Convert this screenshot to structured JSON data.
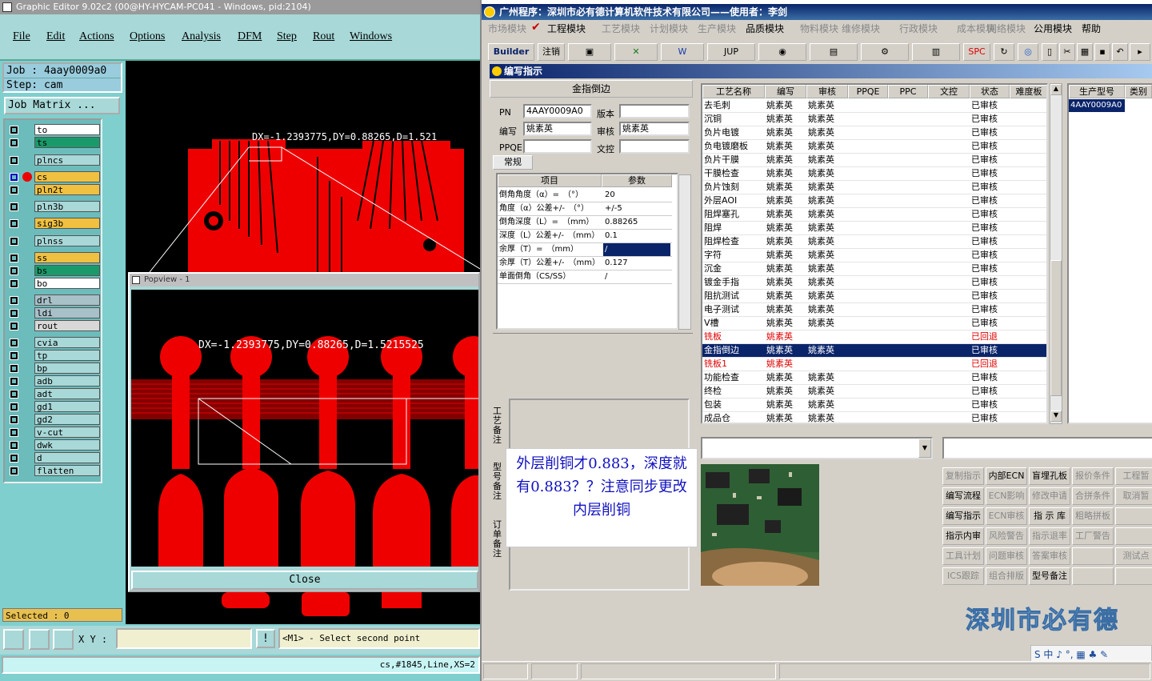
{
  "ge": {
    "title": "Graphic Editor 9.02c2 (00@HY-HYCAM-PC041 - Windows, pid:2104)",
    "menu": [
      "File",
      "Edit",
      "Actions",
      "Options",
      "Analysis",
      "DFM",
      "Step",
      "Rout",
      "Windows"
    ],
    "job": "Job : 4aay0009a0",
    "step": "Step: cam",
    "job_matrix": "Job Matrix ...",
    "layers": [
      {
        "name": "to",
        "color": "#ffffff"
      },
      {
        "name": "ts",
        "color": "#1a9a6a"
      },
      {
        "name": "plncs",
        "color": "#a8d8d8"
      },
      {
        "name": "cs",
        "color": "#f0c040"
      },
      {
        "name": "pln2t",
        "color": "#f0c040"
      },
      {
        "name": "pln3b",
        "color": "#a8d8d8"
      },
      {
        "name": "sig3b",
        "color": "#f0c040"
      },
      {
        "name": "plnss",
        "color": "#a8d8d8"
      },
      {
        "name": "ss",
        "color": "#f0c040"
      },
      {
        "name": "bs",
        "color": "#1a9a6a"
      },
      {
        "name": "bo",
        "color": "#ffffff"
      },
      {
        "name": "drl",
        "color": "#a8c0c8"
      },
      {
        "name": "ldi",
        "color": "#a8c0c8"
      },
      {
        "name": "rout",
        "color": "#d8d8d8"
      },
      {
        "name": "cvia",
        "color": "#a8d8d8"
      },
      {
        "name": "tp",
        "color": "#a8d8d8"
      },
      {
        "name": "bp",
        "color": "#a8d8d8"
      },
      {
        "name": "adb",
        "color": "#a8d8d8"
      },
      {
        "name": "adt",
        "color": "#a8d8d8"
      },
      {
        "name": "gd1",
        "color": "#a8d8d8"
      },
      {
        "name": "gd2",
        "color": "#a8d8d8"
      },
      {
        "name": "v-cut",
        "color": "#a8d8d8"
      },
      {
        "name": "dwk",
        "color": "#a8d8d8"
      },
      {
        "name": "d",
        "color": "#a8d8d8"
      },
      {
        "name": "flatten",
        "color": "#a8d8d8"
      }
    ],
    "canvas_measure": "DX=-1.2393775,DY=0.88265,D=1.521",
    "popview_title": "Popview - 1",
    "popview_measure": "DX=-1.2393775,DY=0.88265,D=1.5215525",
    "close": "Close",
    "selected": "Selected : 0",
    "xy_label": "X Y :",
    "excl": "!",
    "prompt": "<M1> - Select second point",
    "status": "cs,#1845,Line,XS=2"
  },
  "erp": {
    "title": "广州程序：深圳市必有德计算机软件技术有限公司——使用者：李剑",
    "menu": [
      {
        "label": "市场模块",
        "enabled": false
      },
      {
        "label": "工程模块",
        "enabled": true
      },
      {
        "label": "工艺模块",
        "enabled": false
      },
      {
        "label": "计划模块",
        "enabled": false
      },
      {
        "label": "生产模块",
        "enabled": false
      },
      {
        "label": "品质模块",
        "enabled": true
      },
      {
        "label": "物料模块",
        "enabled": false
      },
      {
        "label": "维修模块",
        "enabled": false
      },
      {
        "label": "行政模块",
        "enabled": false
      },
      {
        "label": "成本模块",
        "enabled": false
      },
      {
        "label": "网络模块",
        "enabled": false
      },
      {
        "label": "公用模块",
        "enabled": true
      },
      {
        "label": "帮助",
        "enabled": true
      }
    ],
    "toolbar": [
      "Builder",
      "注销",
      "JUP",
      "SPC"
    ],
    "inner_title": "编写指示",
    "form": {
      "heading": "金指倒边",
      "pn_label": "PN",
      "pn": "4AAY0009A0",
      "version_label": "版本",
      "version": "",
      "writer_label": "编写",
      "writer": "姚素英",
      "reviewer_label": "审核",
      "reviewer": "姚素英",
      "ppqe_label": "PPQE",
      "ppqe": "",
      "doc_label": "文控",
      "doc": "",
      "tab": "常规"
    },
    "params": {
      "headers": [
        "项目",
        "参数"
      ],
      "rows": [
        [
          "倒角角度（α）=　（°）",
          "20"
        ],
        [
          "角度（α）公差+/-　（°）",
          "+/-5"
        ],
        [
          "倒角深度（L）=　（mm）",
          "0.88265"
        ],
        [
          "深度（L）公差+/-　（mm）",
          "0.1"
        ],
        [
          "余厚（T）=　（mm）",
          "/"
        ],
        [
          "余厚（T）公差+/-　（mm）",
          "0.127"
        ],
        [
          "单面倒角（CS/SS）",
          "/"
        ]
      ]
    },
    "note": "外层削铜才0.883，深度就有0.883？？注意同步更改内层削铜",
    "side_labels": [
      "工艺备注",
      "型号备注",
      "订单备注"
    ],
    "process": {
      "headers": [
        "工艺名称",
        "编写",
        "审核",
        "PPQE",
        "PPC",
        "文控",
        "状态",
        "难度板"
      ],
      "rows": [
        {
          "name": "去毛刺",
          "w": "姚素英",
          "r": "姚素英",
          "s": "已审核",
          "t": ""
        },
        {
          "name": "沉铜",
          "w": "姚素英",
          "r": "姚素英",
          "s": "已审核",
          "t": ""
        },
        {
          "name": "负片电镀",
          "w": "姚素英",
          "r": "姚素英",
          "s": "已审核",
          "t": ""
        },
        {
          "name": "负电镀磨板",
          "w": "姚素英",
          "r": "姚素英",
          "s": "已审核",
          "t": ""
        },
        {
          "name": "负片干膜",
          "w": "姚素英",
          "r": "姚素英",
          "s": "已审核",
          "t": ""
        },
        {
          "name": "干膜检查",
          "w": "姚素英",
          "r": "姚素英",
          "s": "已审核",
          "t": ""
        },
        {
          "name": "负片蚀刻",
          "w": "姚素英",
          "r": "姚素英",
          "s": "已审核",
          "t": ""
        },
        {
          "name": "外层AOI",
          "w": "姚素英",
          "r": "姚素英",
          "s": "已审核",
          "t": ""
        },
        {
          "name": "阻焊塞孔",
          "w": "姚素英",
          "r": "姚素英",
          "s": "已审核",
          "t": ""
        },
        {
          "name": "阻焊",
          "w": "姚素英",
          "r": "姚素英",
          "s": "已审核",
          "t": ""
        },
        {
          "name": "阻焊检查",
          "w": "姚素英",
          "r": "姚素英",
          "s": "已审核",
          "t": ""
        },
        {
          "name": "字符",
          "w": "姚素英",
          "r": "姚素英",
          "s": "已审核",
          "t": ""
        },
        {
          "name": "沉金",
          "w": "姚素英",
          "r": "姚素英",
          "s": "已审核",
          "t": ""
        },
        {
          "name": "镀金手指",
          "w": "姚素英",
          "r": "姚素英",
          "s": "已审核",
          "t": ""
        },
        {
          "name": "阻抗测试",
          "w": "姚素英",
          "r": "姚素英",
          "s": "已审核",
          "t": ""
        },
        {
          "name": "电子测试",
          "w": "姚素英",
          "r": "姚素英",
          "s": "已审核",
          "t": ""
        },
        {
          "name": "V槽",
          "w": "姚素英",
          "r": "姚素英",
          "s": "已审核",
          "t": ""
        },
        {
          "name": "铣板",
          "w": "姚素英",
          "r": "",
          "s": "已回退",
          "t": "red"
        },
        {
          "name": "金指倒边",
          "w": "姚素英",
          "r": "姚素英",
          "s": "已审核",
          "t": "sel"
        },
        {
          "name": "铣板1",
          "w": "姚素英",
          "r": "",
          "s": "已回退",
          "t": "red"
        },
        {
          "name": "功能检查",
          "w": "姚素英",
          "r": "姚素英",
          "s": "已审核",
          "t": ""
        },
        {
          "name": "终检",
          "w": "姚素英",
          "r": "姚素英",
          "s": "已审核",
          "t": ""
        },
        {
          "name": "包装",
          "w": "姚素英",
          "r": "姚素英",
          "s": "已审核",
          "t": ""
        },
        {
          "name": "成品仓",
          "w": "姚素英",
          "r": "姚素英",
          "s": "已审核",
          "t": ""
        }
      ]
    },
    "model": {
      "headers": [
        "生产型号",
        "类别"
      ],
      "value": "4AAY0009A0"
    },
    "buttons": [
      {
        "label": "复制指示",
        "enabled": false
      },
      {
        "label": "内部ECN",
        "enabled": true
      },
      {
        "label": "盲埋孔板",
        "enabled": true
      },
      {
        "label": "报价条件",
        "enabled": false
      },
      {
        "label": "工程暂",
        "enabled": false
      },
      {
        "label": "编写流程",
        "enabled": true
      },
      {
        "label": "ECN影响",
        "enabled": false
      },
      {
        "label": "修改申请",
        "enabled": false
      },
      {
        "label": "合拼条件",
        "enabled": false
      },
      {
        "label": "取消暂",
        "enabled": false
      },
      {
        "label": "编写指示",
        "enabled": true
      },
      {
        "label": "ECN审核",
        "enabled": false
      },
      {
        "label": "指 示 库",
        "enabled": true
      },
      {
        "label": "粗略拼板",
        "enabled": false
      },
      {
        "label": "",
        "enabled": false
      },
      {
        "label": "指示内审",
        "enabled": true
      },
      {
        "label": "风险警告",
        "enabled": false
      },
      {
        "label": "指示退率",
        "enabled": false
      },
      {
        "label": "工厂警告",
        "enabled": false
      },
      {
        "label": "",
        "enabled": false
      },
      {
        "label": "工具计划",
        "enabled": false
      },
      {
        "label": "问题审核",
        "enabled": false
      },
      {
        "label": "答案审核",
        "enabled": false
      },
      {
        "label": "",
        "enabled": false
      },
      {
        "label": "测试点",
        "enabled": false
      },
      {
        "label": "ICS跟踪",
        "enabled": false
      },
      {
        "label": "组合排版",
        "enabled": false
      },
      {
        "label": "型号备注",
        "enabled": true
      },
      {
        "label": "",
        "enabled": false
      },
      {
        "label": "",
        "enabled": false
      }
    ],
    "brand": "深圳市必有德",
    "ime": "S 中 ♪ °, ▦ ♣ ✎"
  }
}
